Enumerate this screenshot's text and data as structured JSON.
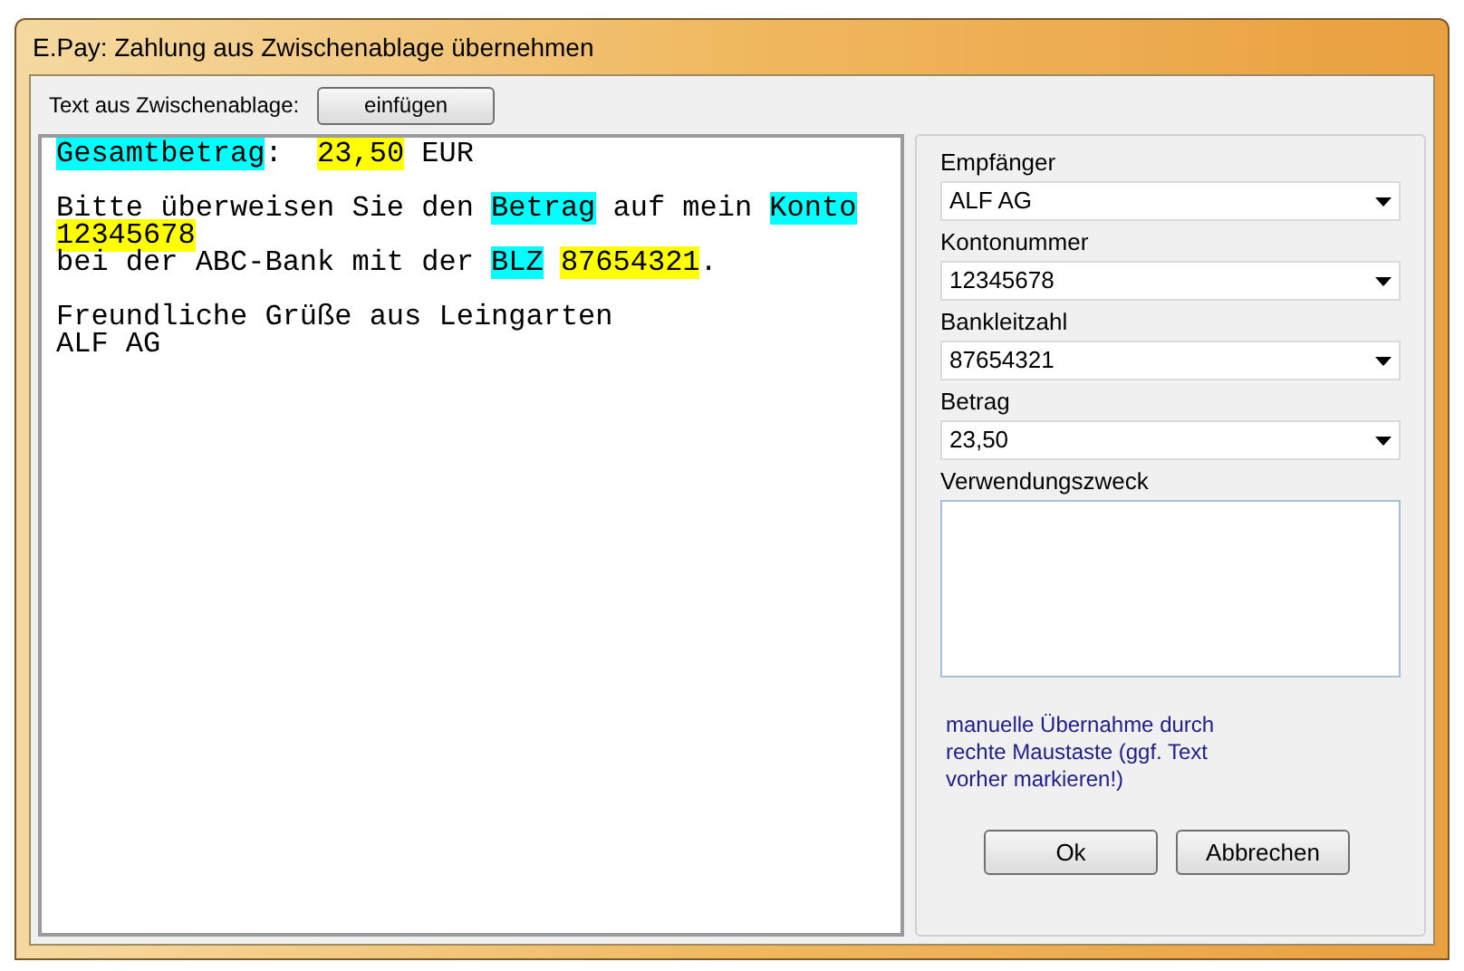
{
  "window": {
    "title": "E.Pay: Zahlung aus Zwischenablage übernehmen"
  },
  "toolbar": {
    "label": "Text aus Zwischenablage:",
    "button": "einfügen"
  },
  "clipboard_text": {
    "paragraphs": [
      {
        "lines": [
          [
            {
              "text": "Gesamtbetrag",
              "color": "#00ffff"
            },
            {
              "text": ":  "
            },
            {
              "text": "23,50",
              "color": "#ffff00"
            },
            {
              "text": " EUR"
            }
          ]
        ]
      },
      {
        "lines": [
          [
            {
              "text": "Bitte überweisen Sie den "
            },
            {
              "text": "Betrag",
              "color": "#00ffff"
            },
            {
              "text": " auf mein "
            },
            {
              "text": "Konto",
              "color": "#00ffff"
            }
          ],
          [
            {
              "text": "12345678",
              "color": "#ffff00"
            }
          ],
          [
            {
              "text": "bei der ABC-Bank mit der "
            },
            {
              "text": "BLZ",
              "color": "#00ffff",
              "space_after": true
            },
            {
              "text": "87654321",
              "color": "#ffff00"
            },
            {
              "text": "."
            }
          ]
        ]
      },
      {
        "lines": [
          [
            {
              "text": "Freundliche Grüße aus Leingarten"
            }
          ],
          [
            {
              "text": "ALF AG"
            }
          ]
        ]
      }
    ]
  },
  "fields": [
    {
      "label": "Empfänger",
      "value": "ALF AG"
    },
    {
      "label": "Kontonummer",
      "value": "12345678"
    },
    {
      "label": "Bankleitzahl",
      "value": "87654321"
    },
    {
      "label": "Betrag",
      "value": "23,50"
    }
  ],
  "purpose": {
    "label": "Verwendungszweck"
  },
  "hint": "manuelle Übernahme durch rechte Maustaste (ggf. Text vorher markieren!)",
  "buttons": [
    "Ok",
    "Abbrechen"
  ]
}
